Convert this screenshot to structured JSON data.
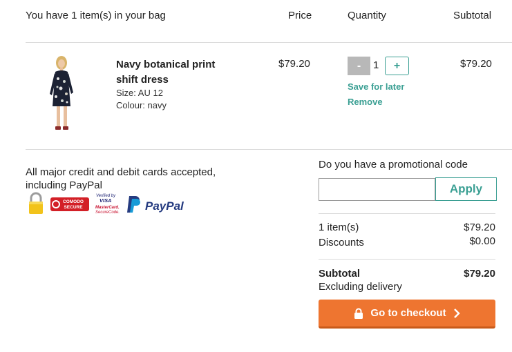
{
  "header": {
    "title": "You have 1 item(s) in your bag",
    "price": "Price",
    "quantity": "Quantity",
    "subtotal": "Subtotal"
  },
  "item": {
    "name": "Navy botanical print shift dress",
    "size": "Size: AU 12",
    "colour": "Colour: navy",
    "price": "$79.20",
    "quantity": "1",
    "minus": "-",
    "plus": "+",
    "subtotal": "$79.20",
    "save_for_later": "Save for later",
    "remove": "Remove"
  },
  "payment": {
    "text": "All major credit and debit cards accepted, including PayPal",
    "logos": {
      "comodo_line1": "COMODO",
      "comodo_line2": "SECURE",
      "verified_line1": "Verified by",
      "verified_line2": "VISA",
      "verified_line3": "MasterCard.",
      "verified_line4": "SecureCode.",
      "paypal": "PayPal"
    }
  },
  "promo": {
    "label": "Do you have a promotional code",
    "input_value": "",
    "apply": "Apply"
  },
  "summary": {
    "items_label": "1 item(s)",
    "items_value": "$79.20",
    "discounts_label": "Discounts",
    "discounts_value": "$0.00",
    "subtotal_label": "Subtotal",
    "subtotal_value": "$79.20",
    "excluding_delivery": "Excluding delivery"
  },
  "checkout": {
    "label": "Go to checkout"
  },
  "colors": {
    "accent_teal": "#3a9f93",
    "checkout_orange": "#ee7530"
  }
}
